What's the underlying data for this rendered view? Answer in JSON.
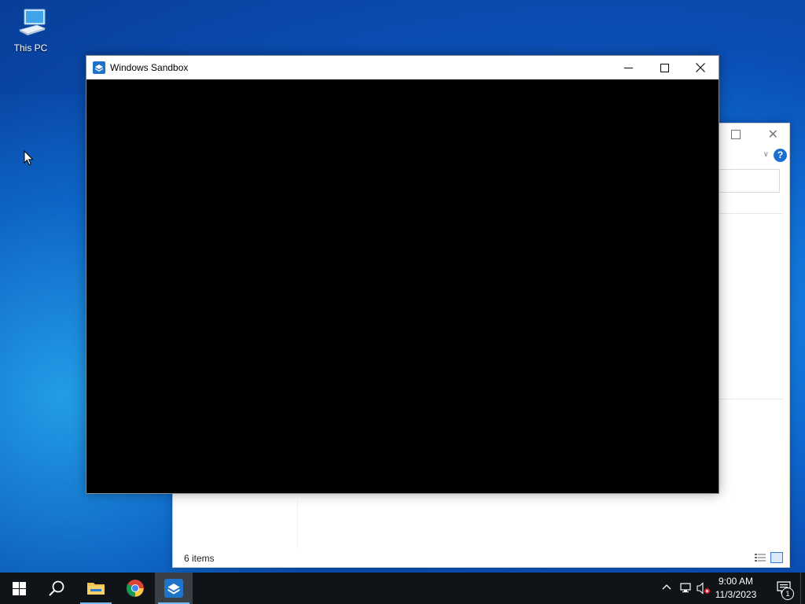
{
  "desktop": {
    "icons": [
      {
        "label": "This PC",
        "icon": "computer-icon"
      }
    ]
  },
  "explorer": {
    "status_text": "6 items",
    "help_label": "?"
  },
  "sandbox_window": {
    "title": "Windows Sandbox",
    "icon": "windows-sandbox-icon",
    "content_color": "#000000"
  },
  "taskbar": {
    "items": [
      {
        "name": "start",
        "icon": "windows-logo-icon",
        "active": false
      },
      {
        "name": "search",
        "icon": "search-icon",
        "active": false
      },
      {
        "name": "file-explorer",
        "icon": "folder-icon",
        "active": false
      },
      {
        "name": "chrome",
        "icon": "chrome-icon",
        "active": false
      },
      {
        "name": "windows-sandbox",
        "icon": "windows-sandbox-icon",
        "active": true
      }
    ],
    "clock": {
      "time": "9:00 AM",
      "date": "11/3/2023"
    },
    "notification_count": "1"
  },
  "colors": {
    "desktop_accent": "#0f6fd6",
    "taskbar": "#101418",
    "active_indicator": "#76b9ed"
  }
}
